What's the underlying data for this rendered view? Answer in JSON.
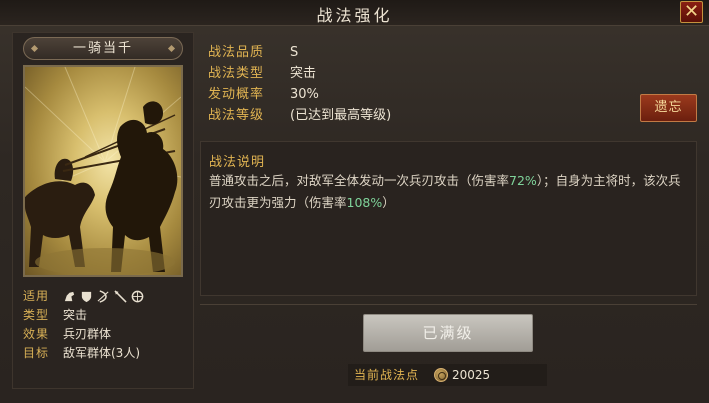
{
  "window": {
    "title": "战法强化",
    "close_glyph": "✕"
  },
  "tactic": {
    "name": "一骑当千",
    "info": [
      {
        "key": "适用",
        "icons": [
          "cavalry-icon",
          "shield-icon",
          "bow-icon",
          "spear-icon",
          "wheel-icon"
        ]
      },
      {
        "key": "类型",
        "value": "突击"
      },
      {
        "key": "效果",
        "value": "兵刃群体"
      },
      {
        "key": "目标",
        "value": "敌军群体(3人)"
      }
    ]
  },
  "stats": [
    {
      "key": "战法品质",
      "value": "S"
    },
    {
      "key": "战法类型",
      "value": "突击"
    },
    {
      "key": "发动概率",
      "value": "30%"
    },
    {
      "key": "战法等级",
      "value": "(已达到最高等级)"
    }
  ],
  "forget_button": "遗忘",
  "description": {
    "title": "战法说明",
    "part1": "普通攻击之后，对敌军全体发动一次兵刃攻击（伤害率",
    "rate1": "72%",
    "part2": "）；自身为主将时，该次兵刃攻击更为强力（伤害率",
    "rate2": "108%",
    "part3": "）"
  },
  "maxed_button": "已满级",
  "points": {
    "label": "当前战法点",
    "value": "20025"
  },
  "colors": {
    "gold": "#e1b452",
    "highlight": "#7fd39a",
    "button_red": "#9b3a1d"
  }
}
